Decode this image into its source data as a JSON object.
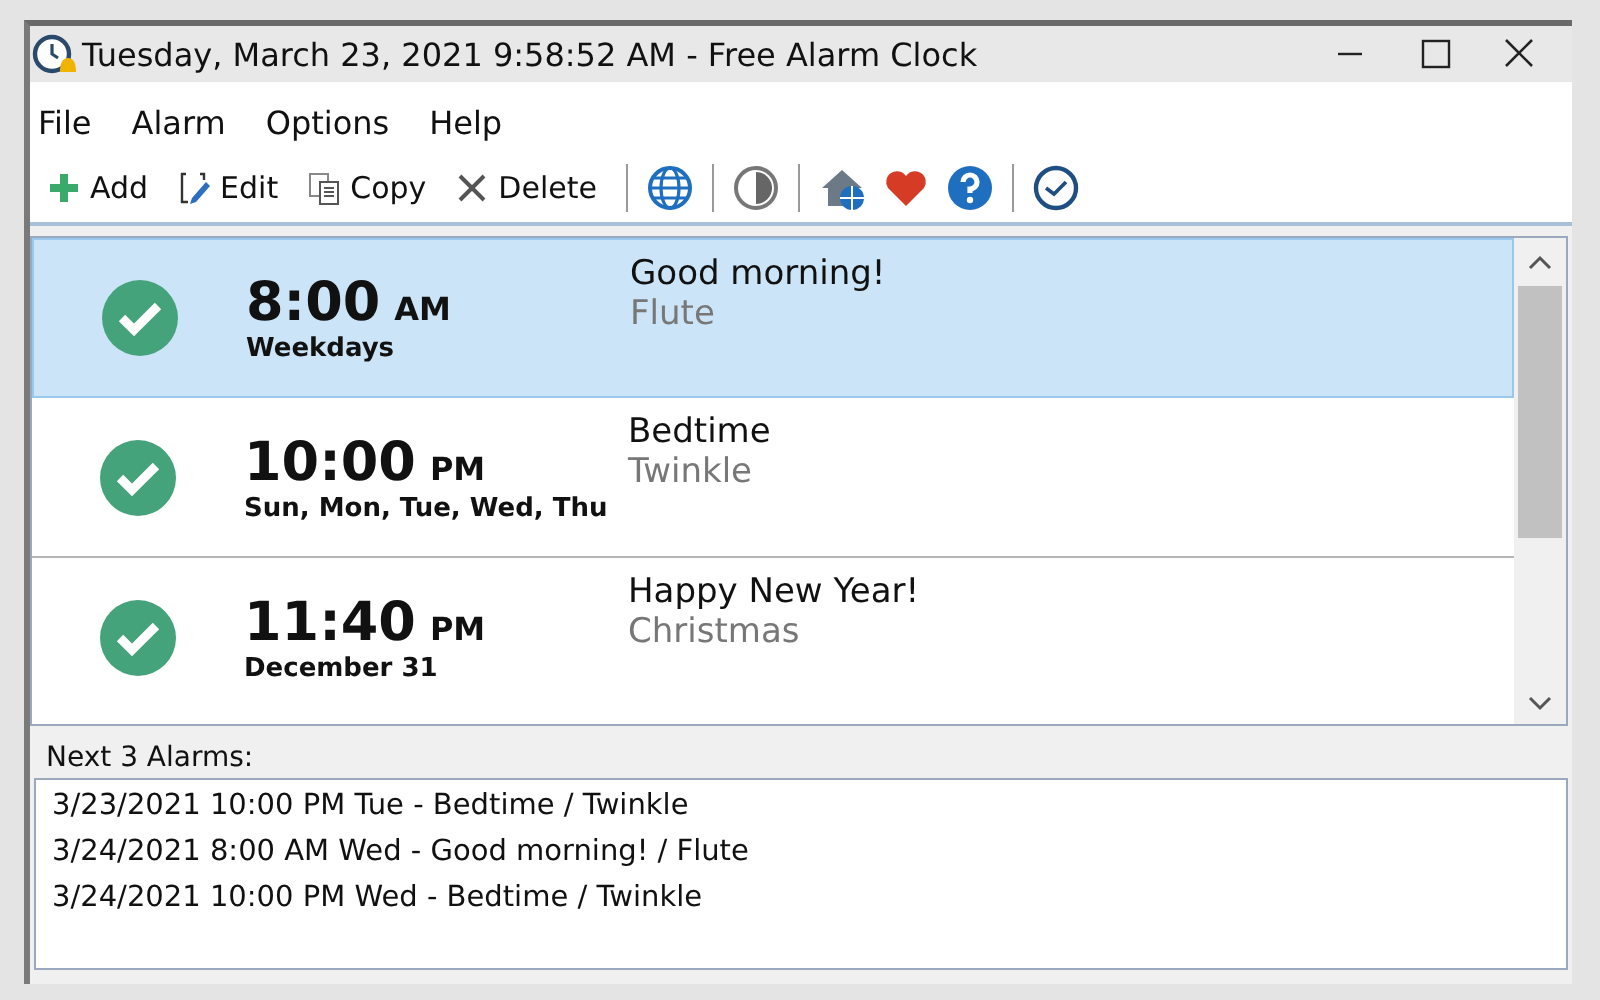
{
  "window": {
    "title": "Tuesday, March 23, 2021 9:58:52 AM - Free Alarm Clock"
  },
  "menu": [
    "File",
    "Alarm",
    "Options",
    "Help"
  ],
  "toolbar": [
    {
      "label": "Add"
    },
    {
      "label": "Edit"
    },
    {
      "label": "Copy"
    },
    {
      "label": "Delete"
    }
  ],
  "alarms": [
    {
      "time": "8:00",
      "ampm": "AM",
      "repeat": "Weekdays",
      "title": "Good morning!",
      "sound": "Flute",
      "enabled": true,
      "selected": true
    },
    {
      "time": "10:00",
      "ampm": "PM",
      "repeat": "Sun, Mon, Tue, Wed, Thu",
      "title": "Bedtime",
      "sound": "Twinkle",
      "enabled": true,
      "selected": false
    },
    {
      "time": "11:40",
      "ampm": "PM",
      "repeat": "December 31",
      "title": "Happy New Year!",
      "sound": "Christmas",
      "enabled": true,
      "selected": false
    }
  ],
  "next_alarms": {
    "label": "Next 3 Alarms:",
    "items": [
      "3/23/2021 10:00 PM Tue - Bedtime / Twinkle",
      "3/24/2021 8:00 AM Wed - Good morning! / Flute",
      "3/24/2021 10:00 PM Wed - Bedtime / Twinkle"
    ]
  }
}
